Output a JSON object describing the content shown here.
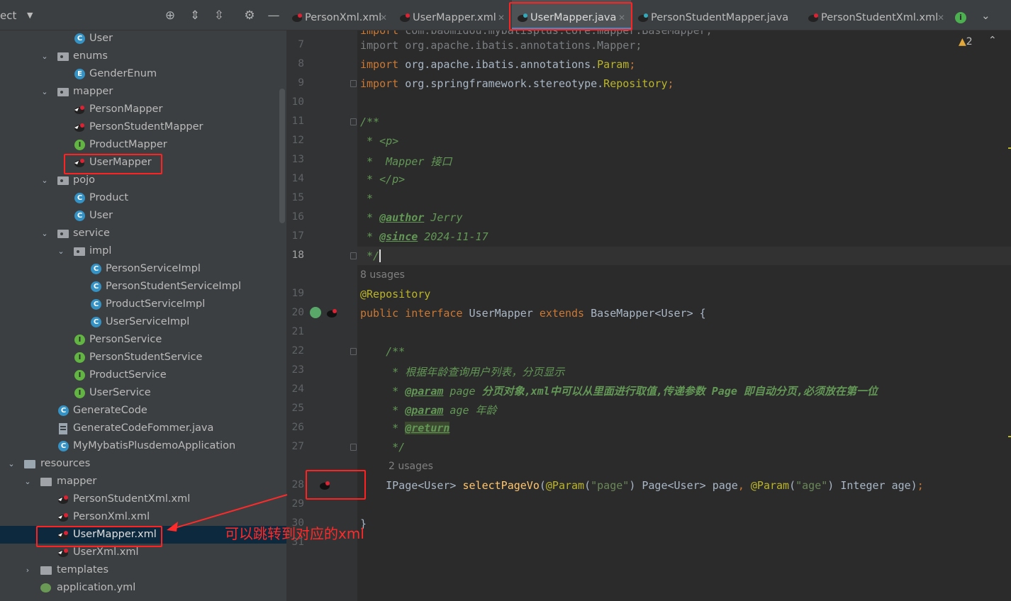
{
  "project_panel": {
    "title": "ect",
    "items": [
      {
        "label": "User",
        "icon": "class-icon"
      },
      {
        "label": "enums",
        "icon": "package-icon"
      },
      {
        "label": "GenderEnum",
        "icon": "enum-icon"
      },
      {
        "label": "mapper",
        "icon": "package-icon"
      },
      {
        "label": "PersonMapper",
        "icon": "mybatis-icon"
      },
      {
        "label": "PersonStudentMapper",
        "icon": "mybatis-icon"
      },
      {
        "label": "ProductMapper",
        "icon": "interface-icon"
      },
      {
        "label": "UserMapper",
        "icon": "mybatis-icon"
      },
      {
        "label": "pojo",
        "icon": "package-icon"
      },
      {
        "label": "Product",
        "icon": "class-icon"
      },
      {
        "label": "User",
        "icon": "class-icon"
      },
      {
        "label": "service",
        "icon": "package-icon"
      },
      {
        "label": "impl",
        "icon": "package-icon"
      },
      {
        "label": "PersonServiceImpl",
        "icon": "class-icon"
      },
      {
        "label": "PersonStudentServiceImpl",
        "icon": "class-icon"
      },
      {
        "label": "ProductServiceImpl",
        "icon": "class-icon"
      },
      {
        "label": "UserServiceImpl",
        "icon": "class-icon"
      },
      {
        "label": "PersonService",
        "icon": "interface-icon"
      },
      {
        "label": "PersonStudentService",
        "icon": "interface-icon"
      },
      {
        "label": "ProductService",
        "icon": "interface-icon"
      },
      {
        "label": "UserService",
        "icon": "interface-icon"
      },
      {
        "label": "GenerateCode",
        "icon": "class-icon"
      },
      {
        "label": "GenerateCodeFommer.java",
        "icon": "java-file-icon"
      },
      {
        "label": "MyMybatisPlusdemoApplication",
        "icon": "spring-class-icon"
      },
      {
        "label": "resources",
        "icon": "resources-folder-icon"
      },
      {
        "label": "mapper",
        "icon": "folder-icon"
      },
      {
        "label": "PersonStudentXml.xml",
        "icon": "mybatis-icon"
      },
      {
        "label": "PersonXml.xml",
        "icon": "mybatis-icon"
      },
      {
        "label": "UserMapper.xml",
        "icon": "mybatis-icon"
      },
      {
        "label": "UserXml.xml",
        "icon": "mybatis-icon"
      },
      {
        "label": "templates",
        "icon": "folder-icon"
      },
      {
        "label": "application.yml",
        "icon": "yml-icon"
      }
    ]
  },
  "tabs": [
    {
      "label": "PersonXml.xml"
    },
    {
      "label": "UserMapper.xml"
    },
    {
      "label": "UserMapper.java"
    },
    {
      "label": "PersonStudentMapper.java"
    },
    {
      "label": "PersonStudentXml.xml"
    }
  ],
  "editor": {
    "warning_count": "2",
    "line_numbers": [
      "7",
      "8",
      "9",
      "10",
      "11",
      "12",
      "13",
      "14",
      "15",
      "16",
      "17",
      "18",
      "19",
      "20",
      "21",
      "22",
      "23",
      "24",
      "25",
      "26",
      "27",
      "28",
      "29",
      "30",
      "31"
    ],
    "hints": {
      "usages_8": "8 usages",
      "usages_2": "2 usages"
    }
  },
  "annotation": "可以跳转到对应的xml",
  "colors": {
    "highlight": "#ff2222",
    "selection": "#0d293e",
    "accent": "#4a88c7"
  }
}
